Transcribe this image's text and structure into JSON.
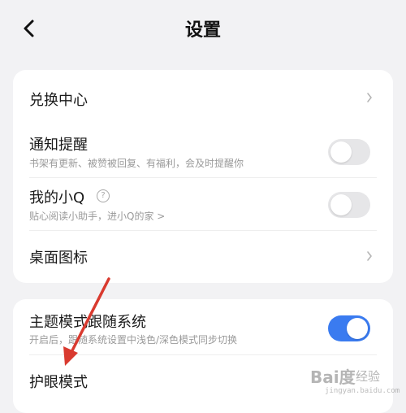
{
  "header": {
    "title": "设置"
  },
  "card1": {
    "items": [
      {
        "label": "兑换中心"
      },
      {
        "label": "通知提醒",
        "subtitle": "书架有更新、被赞被回复、有福利，会及时提醒你",
        "toggle": "off"
      },
      {
        "label": "我的小Q",
        "subtitle": "贴心阅读小助手，进小Q的家 >",
        "toggle": "off"
      },
      {
        "label": "桌面图标"
      }
    ]
  },
  "card2": {
    "items": [
      {
        "label": "主题模式跟随系统",
        "subtitle": "开启后，跟随系统设置中浅色/深色模式同步切换",
        "toggle": "on"
      },
      {
        "label": "护眼模式"
      }
    ]
  },
  "watermark": {
    "logo": "Bai度",
    "sub": "经验",
    "url": "jingyan.baidu.com"
  },
  "colors": {
    "accent": "#3a7bf0",
    "annotation_arrow": "#d93a2f",
    "background": "#f2f2f4"
  },
  "icons": {
    "back": "chevron-left-icon",
    "row_chevron": "chevron-right-icon",
    "help": "question-circle-icon"
  }
}
